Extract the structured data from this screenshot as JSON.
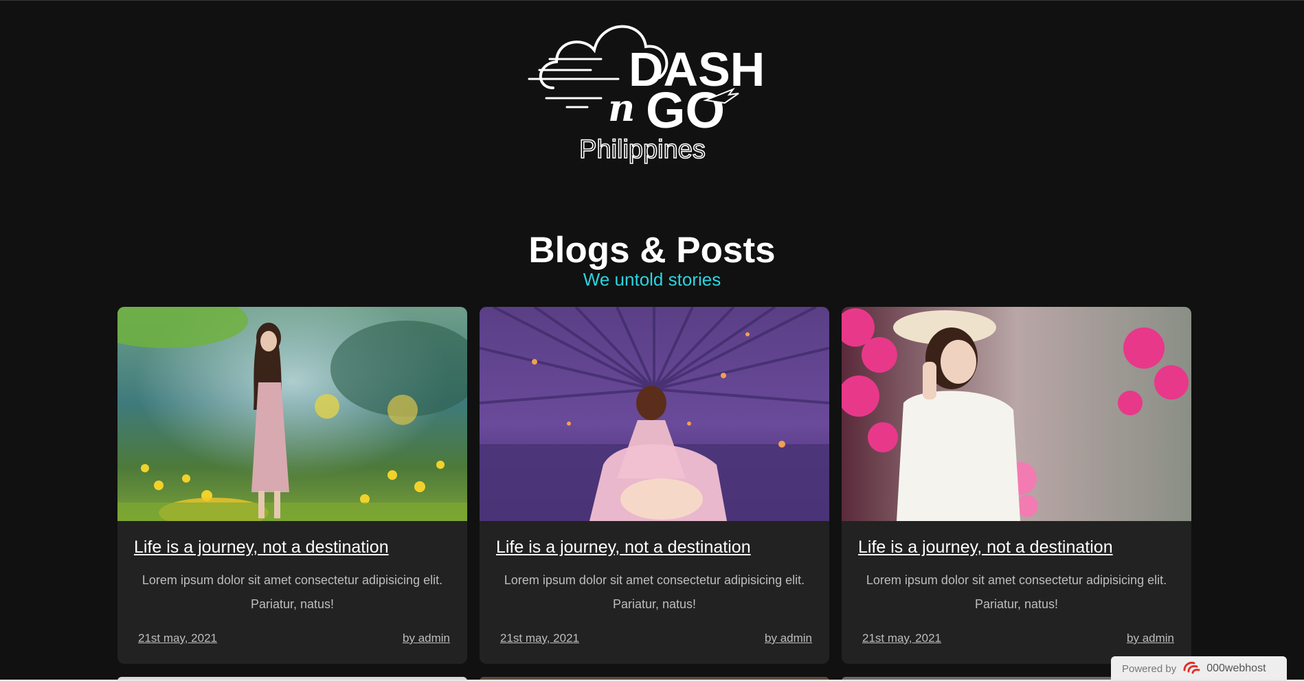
{
  "logo": {
    "wordmark_line1": "DASH",
    "wordmark_line2_n": "n",
    "wordmark_line2_go": "GO",
    "tagline": "Philippines"
  },
  "section": {
    "title": "Blogs & Posts",
    "subtitle": "We untold stories"
  },
  "posts": [
    {
      "title": "Life is a journey, not a destination",
      "excerpt_line1": "Lorem ipsum dolor sit amet consectetur adipisicing elit.",
      "excerpt_line2": "Pariatur, natus!",
      "date": "21st may, 2021",
      "author": "by admin",
      "image": "woman-in-flower-meadow"
    },
    {
      "title": "Life is a journey, not a destination",
      "excerpt_line1": "Lorem ipsum dolor sit amet consectetur adipisicing elit.",
      "excerpt_line2": "Pariatur, natus!",
      "date": "21st may, 2021",
      "author": "by admin",
      "image": "woman-in-lavender-field"
    },
    {
      "title": "Life is a journey, not a destination",
      "excerpt_line1": "Lorem ipsum dolor sit amet consectetur adipisicing elit.",
      "excerpt_line2": "Pariatur, natus!",
      "date": "21st may, 2021",
      "author": "by admin",
      "image": "woman-with-pink-flowers"
    }
  ],
  "badge": {
    "prefix": "Powered by",
    "brand": "000webhost",
    "icon": "000webhost-logo-icon"
  },
  "colors": {
    "background": "#111111",
    "card": "#222222",
    "accent": "#2ad4e0"
  }
}
